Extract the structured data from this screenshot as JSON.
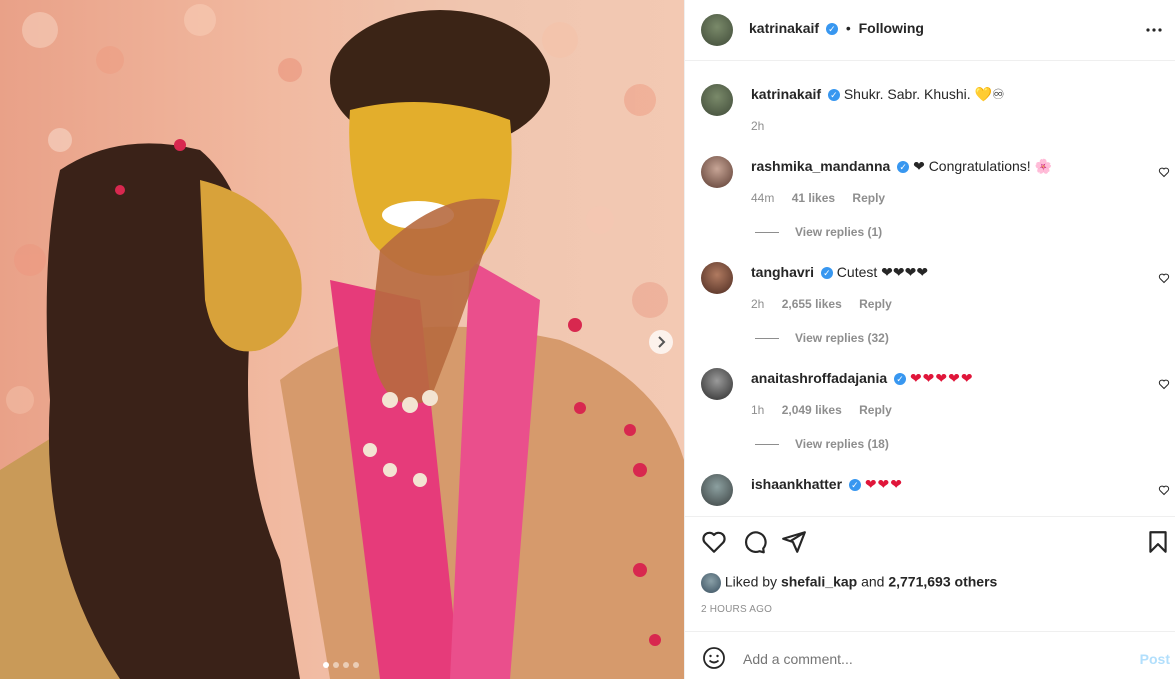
{
  "post": {
    "author": "katrinakaif",
    "follow_state": "Following",
    "caption": "Shukr. Sabr. Khushi.",
    "caption_emojis": "💛♾",
    "caption_time": "2h",
    "liked_by_prefix": "Liked by",
    "liked_by_user": "shefali_kap",
    "liked_by_and": "and",
    "others_count": "2,771,693 others",
    "timestamp": "2 HOURS AGO"
  },
  "comments": [
    {
      "user": "rashmika_mandanna",
      "text": "❤ Congratulations! 🌸",
      "time": "44m",
      "likes": "41 likes",
      "reply": "Reply",
      "view_replies": "View replies (1)"
    },
    {
      "user": "tanghavri",
      "text": "Cutest ❤❤❤❤",
      "time": "2h",
      "likes": "2,655 likes",
      "reply": "Reply",
      "view_replies": "View replies (32)"
    },
    {
      "user": "anaitashroffadajania",
      "text": "❤❤❤❤❤",
      "time": "1h",
      "likes": "2,049 likes",
      "reply": "Reply",
      "view_replies": "View replies (18)"
    },
    {
      "user": "ishaankhatter",
      "text": "❤❤❤"
    }
  ],
  "add_comment": {
    "placeholder": "Add a comment...",
    "post_label": "Post"
  },
  "icons": {
    "more": "more-icon",
    "like": "heart-icon",
    "comment": "comment-icon",
    "share": "share-icon",
    "save": "bookmark-icon",
    "emoji": "emoji-icon",
    "next": "chevron-right-icon"
  },
  "colors": {
    "verified": "#3897f0",
    "post_disabled": "#b2dffc",
    "heart": "#e0163a"
  }
}
